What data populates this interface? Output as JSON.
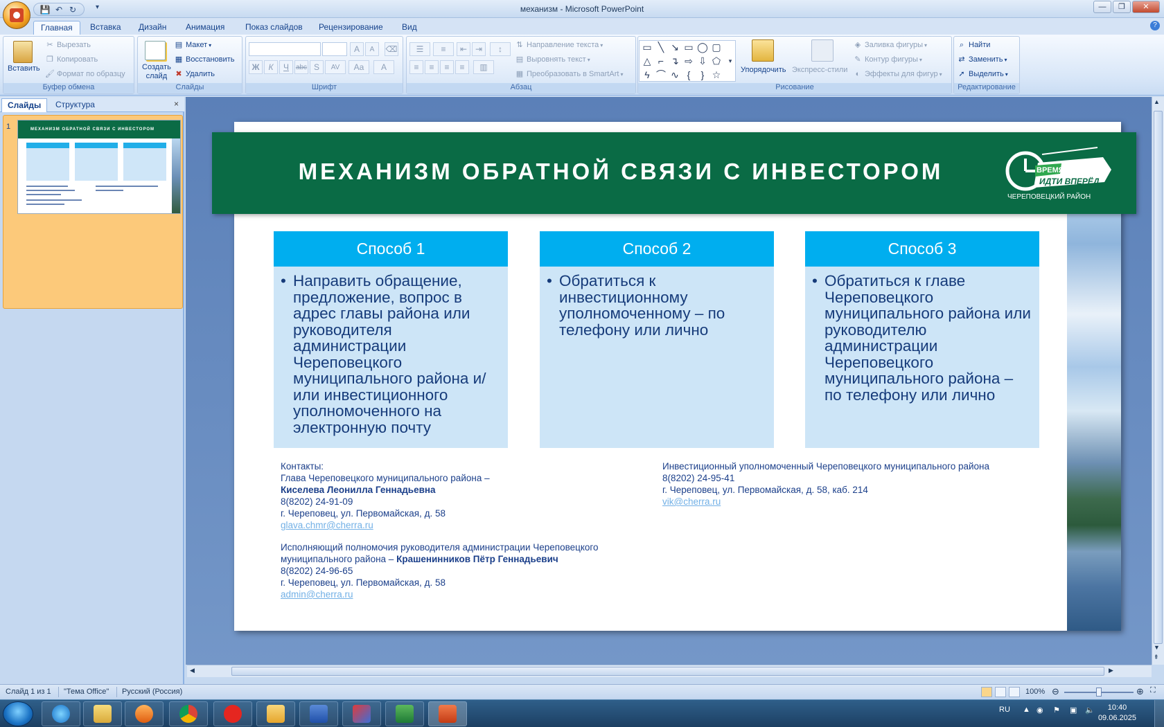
{
  "window": {
    "title": "механизм - Microsoft PowerPoint",
    "qat": {
      "save": "💾",
      "undo": "↶",
      "redo": "↻",
      "more": "▾"
    },
    "controls": {
      "minimize": "—",
      "restore": "❐",
      "close": "✕"
    },
    "help": "?"
  },
  "tabs": [
    "Главная",
    "Вставка",
    "Дизайн",
    "Анимация",
    "Показ слайдов",
    "Рецензирование",
    "Вид"
  ],
  "ribbon": {
    "clipboard": {
      "label": "Буфер обмена",
      "paste": "Вставить",
      "cut": "Вырезать",
      "copy": "Копировать",
      "format_painter": "Формат по образцу"
    },
    "slides": {
      "label": "Слайды",
      "new_slide_1": "Создать",
      "new_slide_2": "слайд",
      "layout": "Макет",
      "reset": "Восстановить",
      "delete": "Удалить"
    },
    "font": {
      "label": "Шрифт",
      "bold": "Ж",
      "italic": "К",
      "underline": "Ч",
      "strike": "abc",
      "shadow": "S",
      "spacing": "AV",
      "case": "Aa",
      "color": "A",
      "grow": "A",
      "shrink": "A"
    },
    "paragraph": {
      "label": "Абзац",
      "text_direction": "Направление текста",
      "align_text": "Выровнять текст",
      "smartart": "Преобразовать в SmartArt"
    },
    "drawing": {
      "label": "Рисование",
      "arrange": "Упорядочить",
      "quick_styles": "Экспресс-стили",
      "shape_fill": "Заливка фигуры",
      "shape_outline": "Контур фигуры",
      "shape_effects": "Эффекты для фигур"
    },
    "editing": {
      "label": "Редактирование",
      "find": "Найти",
      "replace": "Заменить",
      "select": "Выделить"
    }
  },
  "left_pane": {
    "tab_slides": "Слайды",
    "tab_outline": "Структура",
    "close": "×",
    "slide_number": "1",
    "thumb_title": "МЕХАНИЗМ ОБРАТНОЙ СВЯЗИ С ИНВЕСТОРОМ"
  },
  "slide": {
    "title": "МЕХАНИЗМ ОБРАТНОЙ СВЯЗИ С ИНВЕСТОРОМ",
    "logo": {
      "line1": "ВРЕМЯ",
      "line2": "ИДТИ ВПЕРЁД",
      "line3": "ЧЕРЕПОВЕЦКИЙ РАЙОН"
    },
    "columns": [
      {
        "head": "Способ 1",
        "body": "Направить обращение, предложение, вопрос в адрес главы района или руководителя администрации Череповецкого муниципального района и/или инвестиционного уполномоченного на электронную почту"
      },
      {
        "head": "Способ 2",
        "body": "Обратиться к инвестиционному уполномоченному – по телефону или лично"
      },
      {
        "head": "Способ 3",
        "body": "Обратиться к главе Череповецкого муниципального района или руководителю администрации Череповецкого муниципального района – по телефону или лично"
      }
    ],
    "contacts_left": {
      "heading": "Контакты:",
      "head_title": "Глава Череповецкого муниципального района –",
      "head_name": "Киселева Леонилла Геннадьевна",
      "head_phone": "8(8202) 24-91-09",
      "head_address": "г. Череповец, ул. Первомайская, д. 58",
      "head_email": "glava.chmr@cherra.ru",
      "admin_title_1": "Исполняющий полномочия руководителя администрации Череповецкого",
      "admin_title_2": "муниципального района –",
      "admin_name": "Крашенинников Пётр Геннадьевич",
      "admin_phone": "8(8202) 24-96-65",
      "admin_address": "г. Череповец, ул. Первомайская, д. 58",
      "admin_email": "admin@cherra.ru"
    },
    "contacts_right": {
      "title": "Инвестиционный уполномоченный Череповецкого муниципального района",
      "phone": "8(8202) 24-95-41",
      "address": "г. Череповец, ул. Первомайская, д. 58, каб. 214",
      "email": "vik@cherra.ru"
    }
  },
  "status": {
    "slide_count": "Слайд 1 из 1",
    "theme": "\"Тема Office\"",
    "language": "Русский (Россия)",
    "zoom": "100%",
    "zoom_level": 0.5
  },
  "taskbar": {
    "apps": [
      "ie",
      "explorer",
      "media-player",
      "chrome",
      "yandex",
      "outlook",
      "word",
      "anydesk",
      "excel",
      "powerpoint"
    ],
    "tray_lang": "RU",
    "time": "10:40",
    "date": "09.06.2025"
  }
}
